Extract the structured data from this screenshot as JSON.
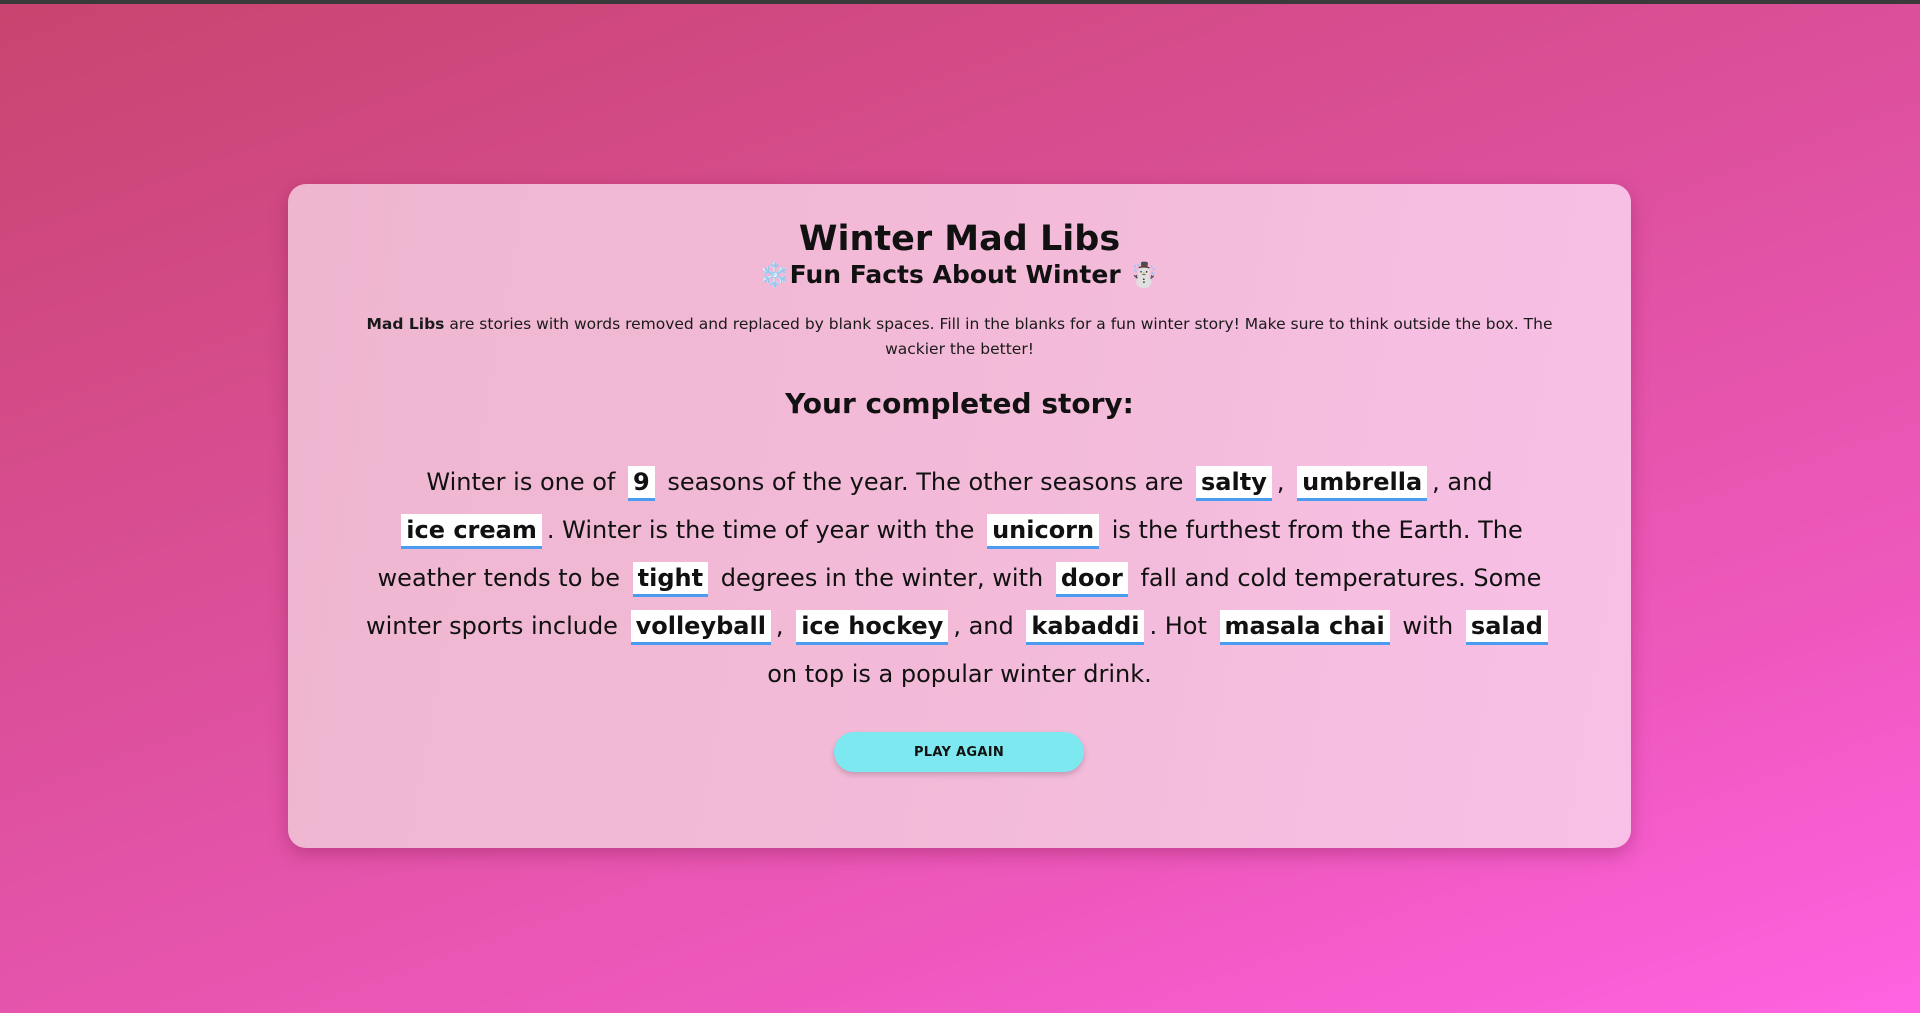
{
  "header": {
    "title": "Winter Mad Libs",
    "subtitle_icon_left": "❄️",
    "subtitle": "Fun Facts About Winter",
    "subtitle_icon_right": "☃️"
  },
  "intro": {
    "bold": "Mad Libs",
    "text": " are stories with words removed and replaced by blank spaces. Fill in the blanks for a fun winter story! Make sure to think outside the box. The wackier the better!"
  },
  "story": {
    "heading": "Your completed story:",
    "segments": [
      "Winter is one of ",
      " seasons of the year. The other seasons are ",
      ", ",
      ", and ",
      ". Winter is the time of year with the ",
      " is the furthest from the Earth. The weather tends to be ",
      " degrees in the winter, with ",
      " fall and cold temperatures. Some winter sports include ",
      ", ",
      ", and ",
      ". Hot ",
      " with ",
      " on top is a popular winter drink."
    ],
    "words": [
      "9",
      "salty",
      "umbrella",
      "ice cream",
      "unicorn",
      "tight",
      "door",
      "volleyball",
      "ice hockey",
      "kabaddi",
      "masala chai",
      "salad"
    ]
  },
  "actions": {
    "play_again_label": "PLAY AGAIN"
  },
  "colors": {
    "background_start": "#c9446f",
    "background_end": "#ff63e2",
    "card": "#f3bbd9",
    "blank_underline": "#4a9cf0",
    "button": "#7ee8f0"
  }
}
